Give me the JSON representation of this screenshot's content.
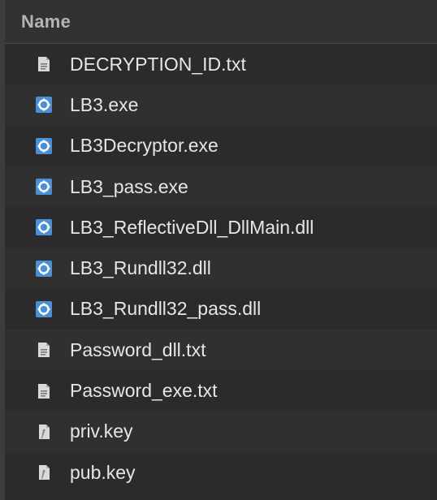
{
  "header": {
    "column_label": "Name"
  },
  "colors": {
    "text": "#e6e6e6",
    "header_text": "#b4b4b4",
    "exe_icon": "#4a90d9",
    "doc_icon": "#d9d9d9",
    "background": "#2b2b2b"
  },
  "files": [
    {
      "name": "DECRYPTION_ID.txt",
      "icon": "text-file-icon"
    },
    {
      "name": "LB3.exe",
      "icon": "executable-gear-icon"
    },
    {
      "name": "LB3Decryptor.exe",
      "icon": "executable-gear-icon"
    },
    {
      "name": "LB3_pass.exe",
      "icon": "executable-gear-icon"
    },
    {
      "name": "LB3_ReflectiveDll_DllMain.dll",
      "icon": "executable-gear-icon"
    },
    {
      "name": "LB3_Rundll32.dll",
      "icon": "executable-gear-icon"
    },
    {
      "name": "LB3_Rundll32_pass.dll",
      "icon": "executable-gear-icon"
    },
    {
      "name": "Password_dll.txt",
      "icon": "text-file-icon"
    },
    {
      "name": "Password_exe.txt",
      "icon": "text-file-icon"
    },
    {
      "name": "priv.key",
      "icon": "key-file-icon"
    },
    {
      "name": "pub.key",
      "icon": "key-file-icon"
    }
  ]
}
